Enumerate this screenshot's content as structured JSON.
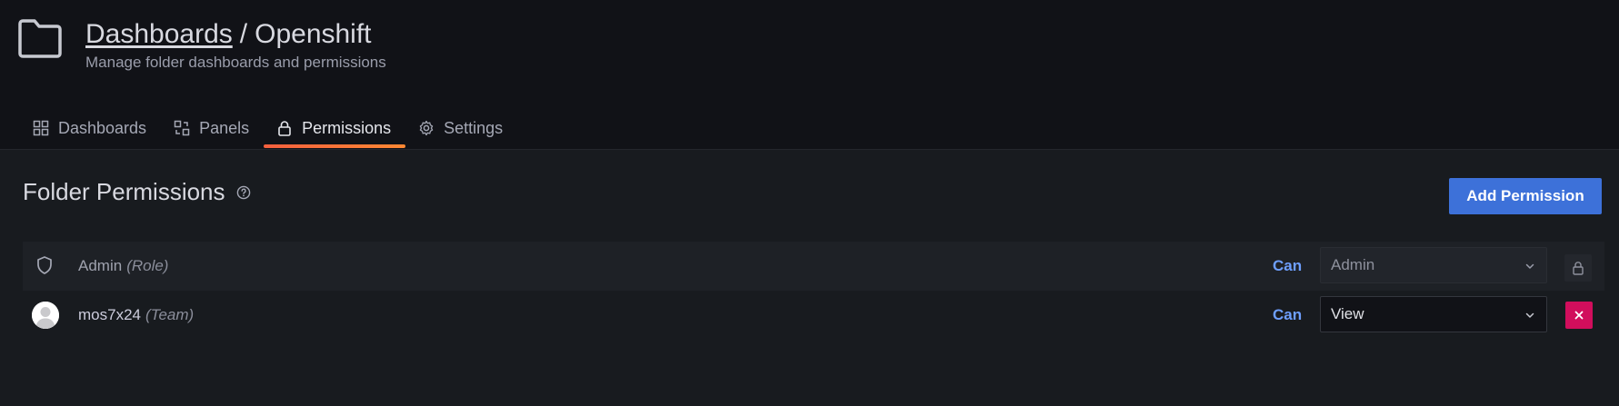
{
  "header": {
    "breadcrumb_parent": "Dashboards",
    "breadcrumb_separator": "/",
    "folder_name": "Openshift",
    "subtitle": "Manage folder dashboards and permissions",
    "icon": "folder-icon"
  },
  "tabs": [
    {
      "label": "Dashboards",
      "icon": "grid-icon",
      "active": false
    },
    {
      "label": "Panels",
      "icon": "library-panels-icon",
      "active": false
    },
    {
      "label": "Permissions",
      "icon": "lock-icon",
      "active": true
    },
    {
      "label": "Settings",
      "icon": "gear-icon",
      "active": false
    }
  ],
  "section": {
    "title": "Folder Permissions",
    "add_button_label": "Add Permission"
  },
  "permissions": [
    {
      "name": "Admin",
      "kind": "(Role)",
      "can_label": "Can",
      "permission": "Admin",
      "icon": "shield-icon",
      "locked": true
    },
    {
      "name": "mos7x24",
      "kind": "(Team)",
      "can_label": "Can",
      "permission": "View",
      "icon": "avatar",
      "locked": false
    }
  ],
  "colors": {
    "accent": "#3d71d9",
    "tab_underline": "#f55f3e",
    "can_text": "#6e9fff",
    "remove_button": "#d10e5c",
    "background": "#181b1f",
    "header_background": "#111217"
  }
}
